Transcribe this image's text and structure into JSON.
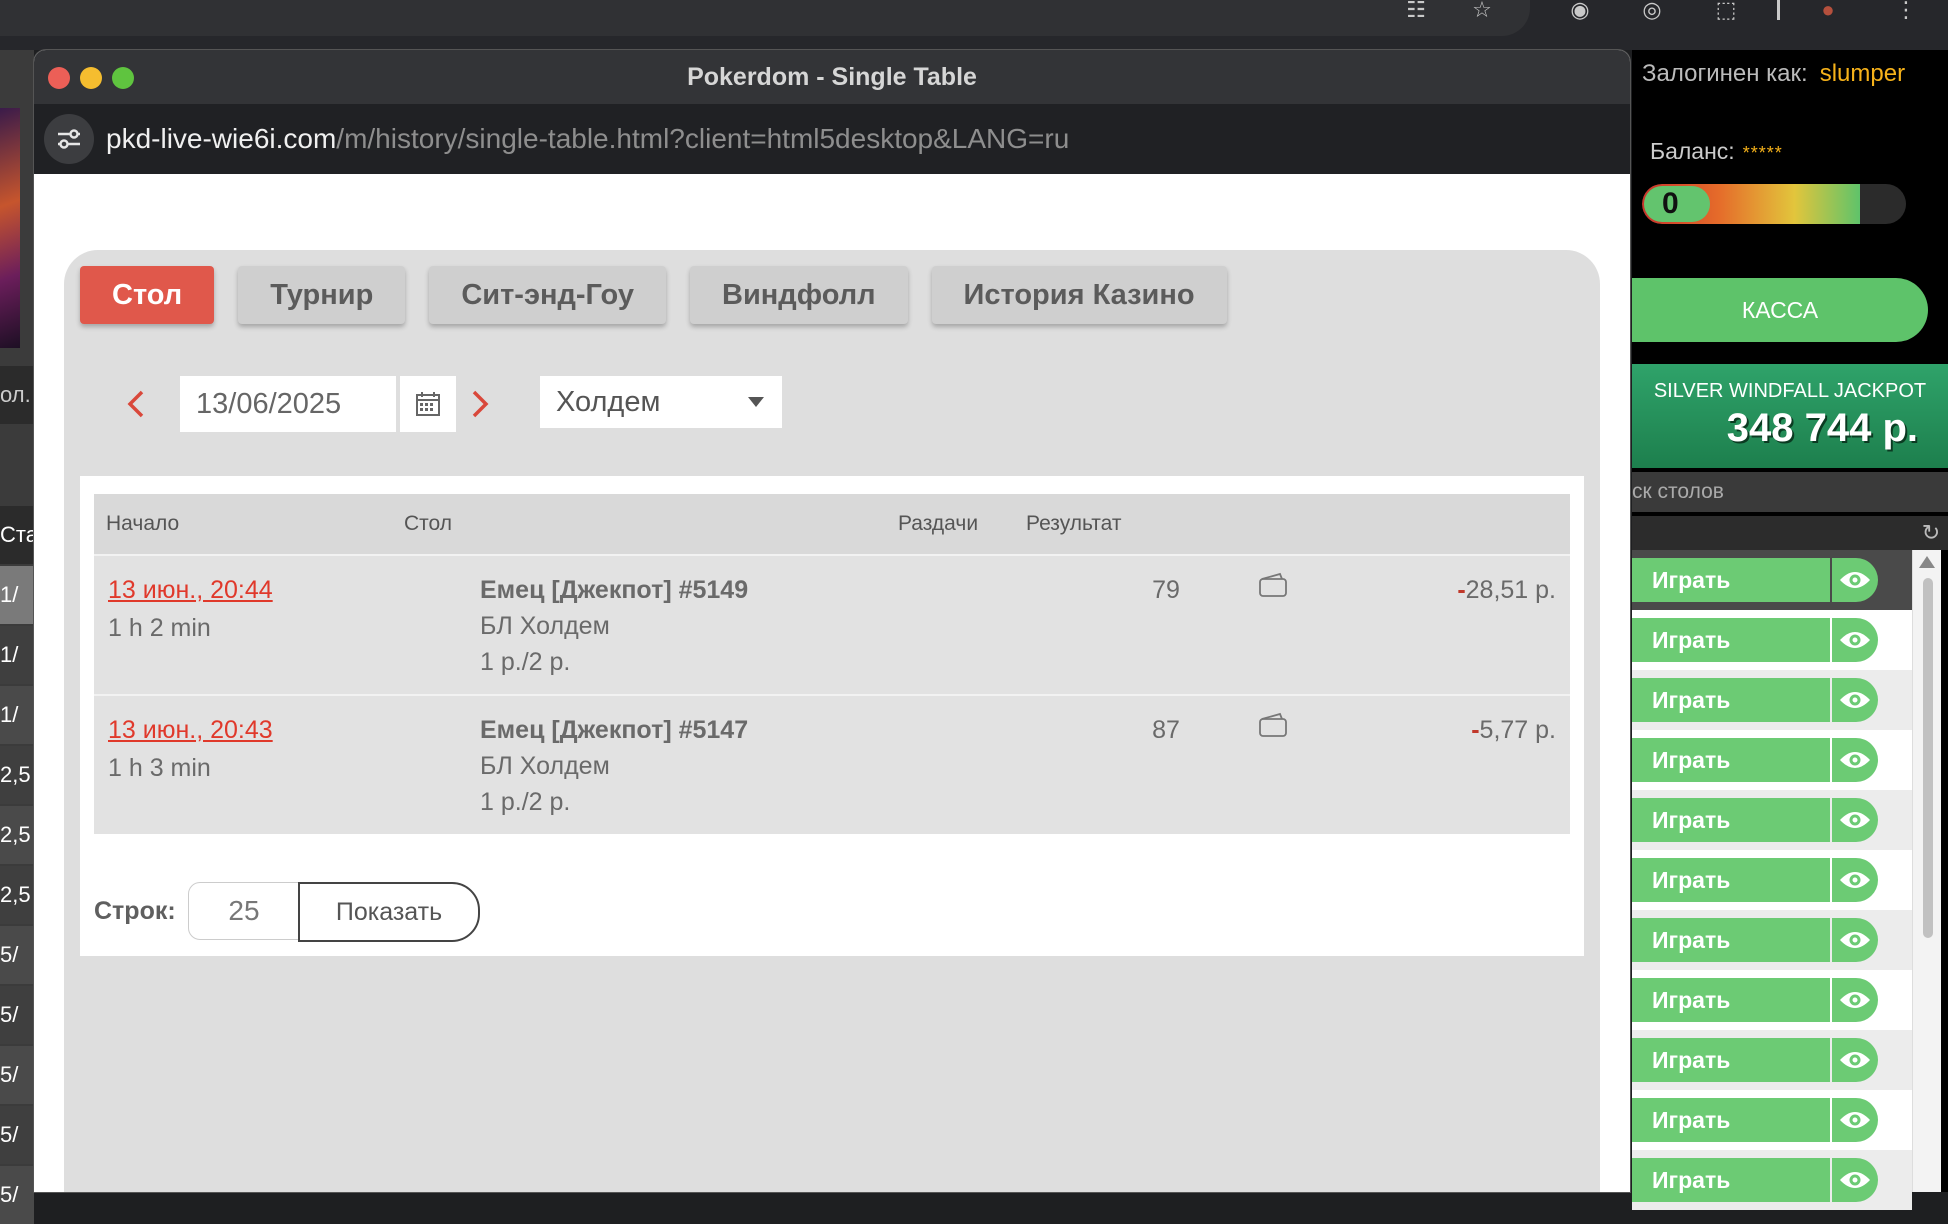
{
  "window": {
    "title": "Pokerdom - Single Table",
    "url_host": "pkd-live-wie6i.com",
    "url_path": "/m/history/single-table.html?client=html5desktop&LANG=ru"
  },
  "tabs": [
    {
      "label": "Стол",
      "active": true
    },
    {
      "label": "Турнир",
      "active": false
    },
    {
      "label": "Сит-энд-Гоу",
      "active": false
    },
    {
      "label": "Виндфолл",
      "active": false
    },
    {
      "label": "История Казино",
      "active": false
    }
  ],
  "filter": {
    "date": "13/06/2025",
    "game": "Холдем"
  },
  "table": {
    "headers": {
      "start": "Начало",
      "table": "Стол",
      "hands": "Раздачи",
      "result": "Результат"
    },
    "rows": [
      {
        "start": "13 июн., 20:44",
        "duration": "1 h 2 min",
        "name": "Емец [Джекпот] #5149",
        "game": "БЛ Холдем",
        "stakes": "1 р./2 р.",
        "hands": "79",
        "result_sign": "-",
        "result": "28,51 р."
      },
      {
        "start": "13 июн., 20:43",
        "duration": "1 h 3 min",
        "name": "Емец [Джекпот] #5147",
        "game": "БЛ Холдем",
        "stakes": "1 р./2 р.",
        "hands": "87",
        "result_sign": "-",
        "result": "5,77 р."
      }
    ]
  },
  "pagination": {
    "rows_label": "Строк:",
    "rows_value": "25",
    "show_label": "Показать"
  },
  "side": {
    "logged_label": "Залогинен как:",
    "username": "slumper",
    "balance_label": "Баланс:",
    "balance_hidden": "*****",
    "level": "0",
    "cashier": "КАССА",
    "jackpot_title": "SILVER WINDFALL JACKPOT",
    "jackpot_value": "348 744 р.",
    "search_label": "ск столов",
    "play_label": "Играть"
  },
  "left_rows": [
    "Ста",
    "1/",
    "1/",
    "1/",
    "2,5",
    "2,5",
    "2,5",
    "5/",
    "5/",
    "5/",
    "5/",
    "5/"
  ],
  "left_fragment": "ол.",
  "colors": {
    "accent_red": "#e0584b",
    "link_red": "#e0392b",
    "play_green": "#6ccb74",
    "username_gold": "#f6b21a"
  }
}
